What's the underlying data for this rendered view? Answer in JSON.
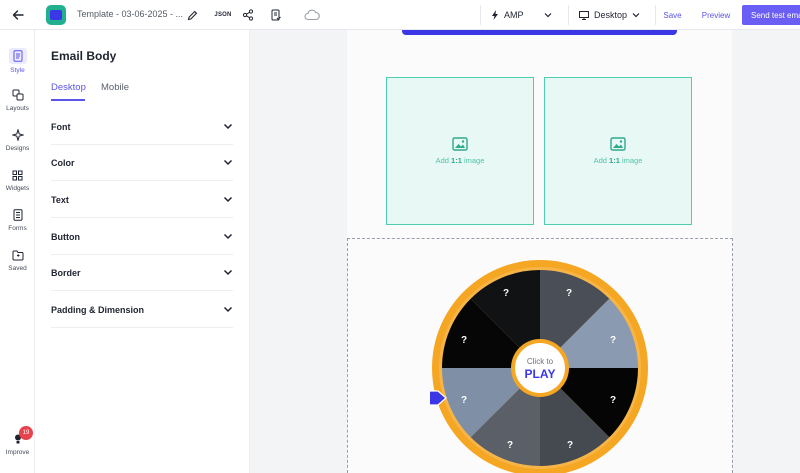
{
  "topbar": {
    "template_name": "Template - 03-06-2025 - ...",
    "json_label": "JSON",
    "amp_select": "AMP",
    "device_select": "Desktop",
    "save": "Save",
    "preview": "Preview",
    "send_test": "Send test email"
  },
  "rail": {
    "items": [
      {
        "label": "Style",
        "icon": "style-icon"
      },
      {
        "label": "Layouts",
        "icon": "layouts-icon"
      },
      {
        "label": "Designs",
        "icon": "designs-icon"
      },
      {
        "label": "Widgets",
        "icon": "widgets-icon"
      },
      {
        "label": "Forms",
        "icon": "forms-icon"
      },
      {
        "label": "Saved",
        "icon": "saved-icon"
      }
    ],
    "improve": {
      "label": "Improve",
      "badge": "19"
    }
  },
  "panel": {
    "title": "Email Body",
    "tabs": [
      "Desktop",
      "Mobile"
    ],
    "active_tab": "Desktop",
    "sections": [
      "Font",
      "Color",
      "Text",
      "Button",
      "Border",
      "Padding & Dimension"
    ]
  },
  "canvas": {
    "image_placeholders": [
      {
        "prefix": "Add ",
        "ratio": "1:1",
        "suffix": " image"
      },
      {
        "prefix": "Add ",
        "ratio": "1:1",
        "suffix": " image"
      }
    ],
    "wheel": {
      "center_top": "Click to",
      "center_main": "PLAY",
      "segment_marks": [
        "?",
        "?",
        "?",
        "?",
        "?",
        "?",
        "?",
        "?"
      ]
    }
  },
  "colors": {
    "accent": "#5a55e8",
    "brand_primary": "#3b37e6",
    "image_box_border": "#4fcdb1",
    "wheel_rim": "#f5a623"
  }
}
